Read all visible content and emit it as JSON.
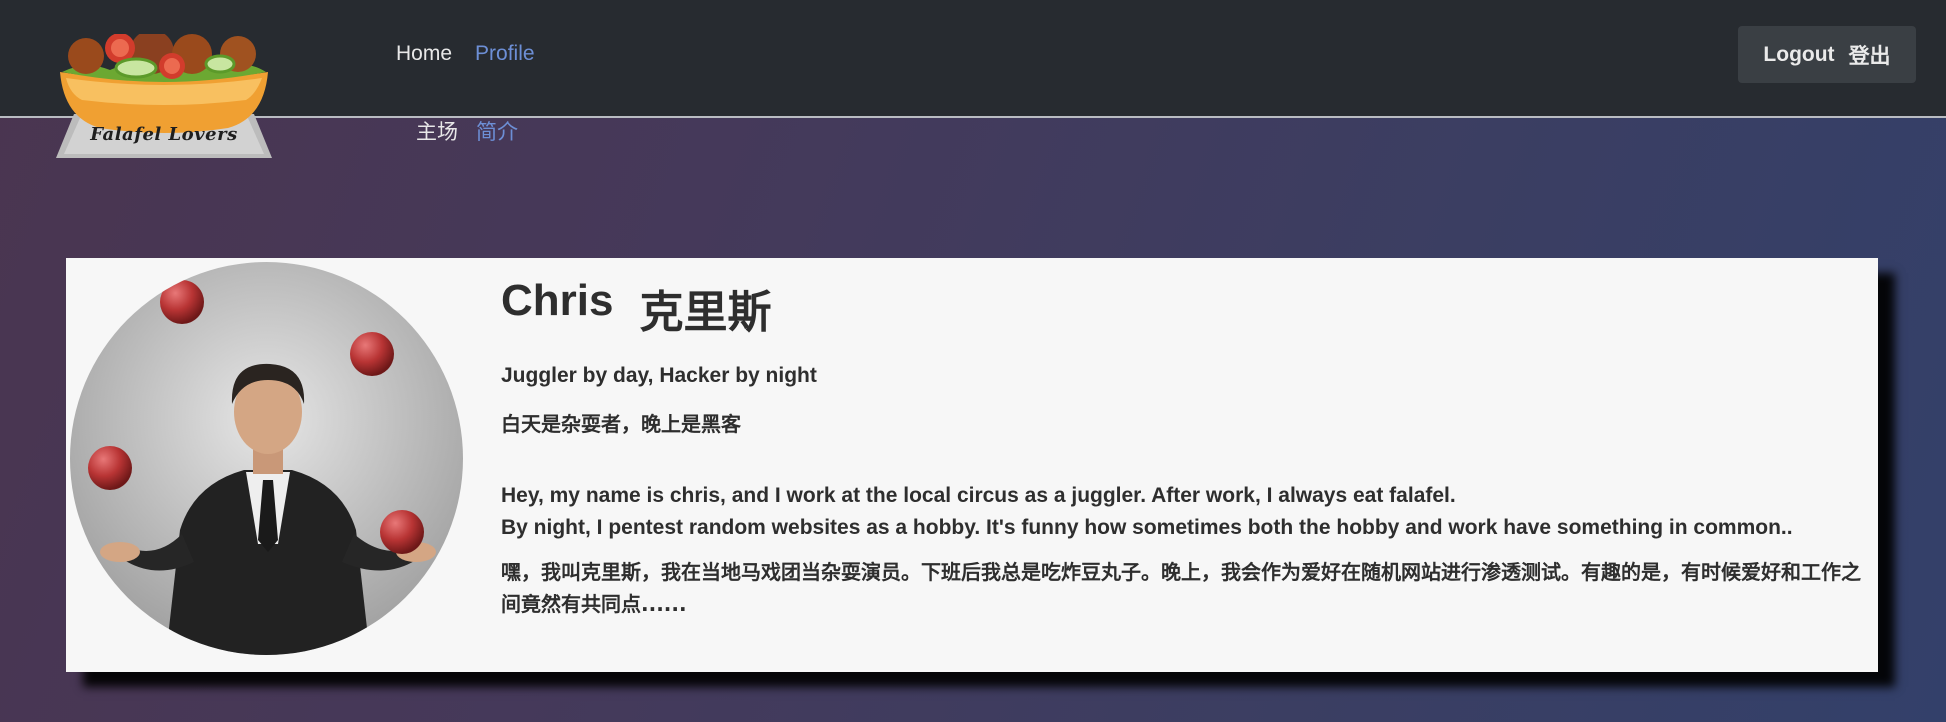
{
  "brand": {
    "logo_text": "Falafel Lovers"
  },
  "nav": {
    "items_en": [
      {
        "label": "Home",
        "active": false
      },
      {
        "label": "Profile",
        "active": true
      }
    ],
    "items_zh": [
      {
        "label": "主场",
        "active": false
      },
      {
        "label": "简介",
        "active": true
      }
    ],
    "logout_label": "Logout",
    "logout_label_zh": "登出"
  },
  "profile": {
    "name": "Chris",
    "name_zh": "克里斯",
    "tagline": "Juggler by day, Hacker by night",
    "tagline_zh": "白天是杂耍者，晚上是黑客",
    "bio_line1": "Hey, my name is chris, and I work at the local circus as a juggler. After work, I always eat falafel.",
    "bio_line2": "By night, I pentest random websites as a hobby. It's funny how sometimes both the hobby and work have something in common..",
    "bio_zh": "嘿，我叫克里斯，我在当地马戏团当杂耍演员。下班后我总是吃炸豆丸子。晚上，我会作为爱好在随机网站进行渗透测试。有趣的是，有时候爱好和工作之间竟然有共同点......"
  },
  "colors": {
    "navbar_bg": "#272b30",
    "active_link": "#6d8fd6",
    "button_bg": "#3a3f44",
    "card_bg": "#f7f7f7",
    "juggling_ball": "#b83434"
  }
}
